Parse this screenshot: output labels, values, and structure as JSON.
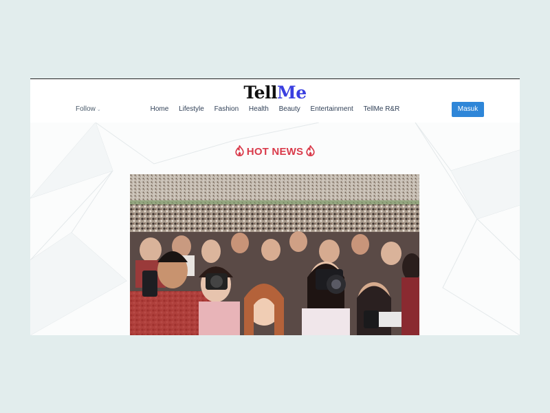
{
  "site": {
    "logo_part1": "Tell",
    "logo_part2": "Me"
  },
  "header": {
    "follow_label": "Follow",
    "nav": [
      "Home",
      "Lifestyle",
      "Fashion",
      "Health",
      "Beauty",
      "Entertainment",
      "TellMe R&R"
    ],
    "login_label": "Masuk"
  },
  "section": {
    "title": "HOT NEWS",
    "icon": "fire-icon",
    "accent": "#d93a4a"
  },
  "hero": {
    "image": "crowd of photographers with cameras and phones in a stadium"
  },
  "colors": {
    "brand_blue": "#3a3fe0",
    "button": "#2e86d8",
    "page_bg": "#e2eded"
  }
}
